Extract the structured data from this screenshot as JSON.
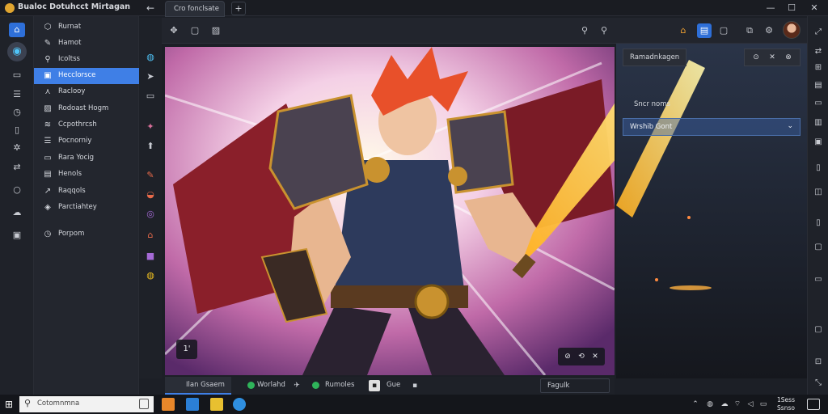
{
  "window": {
    "title": "Bualoc Dotuhcct Mirtagan",
    "back_glyph": "←",
    "minimize_glyph": "—",
    "maximize_glyph": "☐",
    "close_glyph": "✕"
  },
  "tabs": [
    {
      "label": "Cro fonclsate"
    }
  ],
  "new_tab_glyph": "+",
  "rail": {
    "icons": [
      "home-icon",
      "brush-icon",
      "layers-icon",
      "list-icon",
      "clock-icon",
      "file-icon",
      "settings-icon",
      "swap-icon",
      "circle-icon",
      "cloud-icon",
      "image-icon"
    ]
  },
  "sidebar": {
    "items": [
      {
        "label": "Rurnat",
        "icon": "shield-icon",
        "glyph": "⬡"
      },
      {
        "label": "Hamot",
        "icon": "pen-icon",
        "glyph": "✎"
      },
      {
        "label": "Icoltss",
        "icon": "search-icon",
        "glyph": "⚲"
      },
      {
        "label": "Hecclorsce",
        "icon": "box-icon",
        "glyph": "▣",
        "active": true
      },
      {
        "label": "Raclooy",
        "icon": "figure-icon",
        "glyph": "⋏"
      },
      {
        "label": "Rodoast Hogm",
        "icon": "image-icon",
        "glyph": "▨"
      },
      {
        "label": "Ccpothrcsh",
        "icon": "layers-icon",
        "glyph": "≋"
      },
      {
        "label": "Pocnorniy",
        "icon": "list-icon",
        "glyph": "☰"
      },
      {
        "label": "Rara Yocig",
        "icon": "folder-icon",
        "glyph": "▭"
      },
      {
        "label": "Henols",
        "icon": "doc-icon",
        "glyph": "▤"
      },
      {
        "label": "Raqqols",
        "icon": "wand-icon",
        "glyph": "↗"
      },
      {
        "label": "Parctiahtey",
        "icon": "tag-icon",
        "glyph": "◈"
      },
      {
        "label": "Porpom",
        "icon": "clock-icon",
        "glyph": "◷"
      }
    ]
  },
  "tools": [
    "brush-tool-icon",
    "select-tool-icon",
    "crop-tool-icon",
    "eraser-tool-icon",
    "fill-tool-icon",
    "pen-tool-icon",
    "smudge-tool-icon",
    "gradient-tool-icon",
    "color-tool-icon",
    "shape-tool-icon",
    "text-tool-icon"
  ],
  "toolbar": {
    "left_buttons": [
      "share-icon",
      "move-icon",
      "frame-icon",
      "image-icon"
    ],
    "right_buttons": [
      "zoom-icon",
      "zoom-adjust-icon",
      "home-icon",
      "panel-icon",
      "window-icon",
      "layers-icon",
      "gear-icon"
    ]
  },
  "canvas": {
    "zoom_label": "1'",
    "overlay": [
      "lock-icon",
      "loop-icon",
      "close-icon"
    ]
  },
  "right_panel": {
    "title": "Ramadnkagen",
    "controls": [
      "pin-icon",
      "close-icon",
      "link-icon"
    ],
    "row1": "Sncr noms",
    "row2": "Wrshib Gont",
    "row2_chevron": "⌄"
  },
  "layer_bar": {
    "active_tab": "Ilan Gsaem",
    "items": [
      "Worlahd",
      "Fagulk",
      "Rumoles",
      "Gue"
    ],
    "dot_colors": [
      "#2fb35a",
      "#2fb35a",
      "#e0e0e0"
    ],
    "right_label": ""
  },
  "taskbar": {
    "search_placeholder": "Cotomnmna",
    "clock_time": "1Sess",
    "clock_date": "Ssnso"
  }
}
